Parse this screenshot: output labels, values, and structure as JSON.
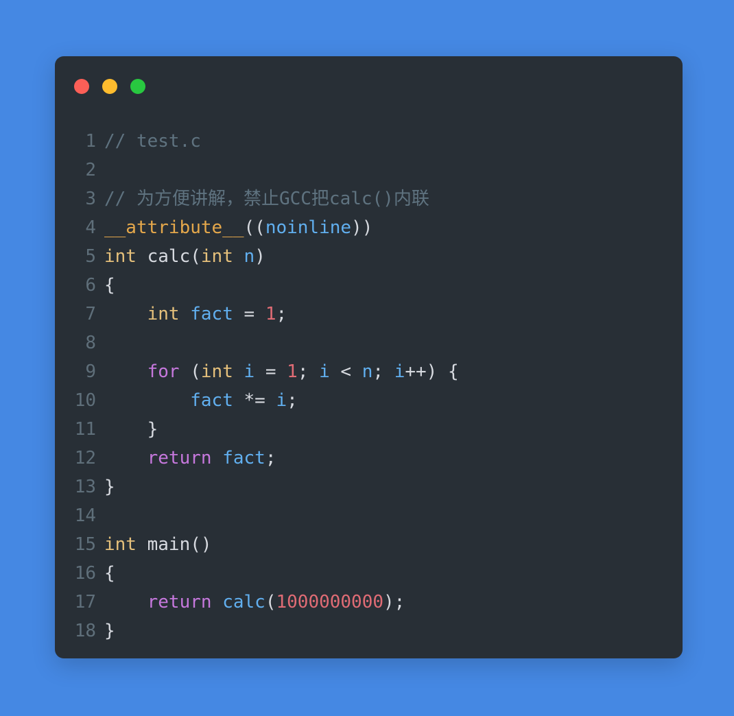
{
  "window": {
    "controls": [
      {
        "name": "close",
        "color": "#fc5f57"
      },
      {
        "name": "minimize",
        "color": "#febc2e"
      },
      {
        "name": "maximize",
        "color": "#28c840"
      }
    ],
    "background_color": "#4588e3",
    "card_color": "#282f36"
  },
  "editor": {
    "language": "c",
    "filename": "test.c",
    "gutter_color": "#5f6f7a",
    "lines": [
      {
        "n": "1",
        "tokens": [
          {
            "t": "// test.c",
            "c": "t-comment"
          }
        ]
      },
      {
        "n": "2",
        "tokens": []
      },
      {
        "n": "3",
        "tokens": [
          {
            "t": "// 为方便讲解，禁止GCC把calc()内联",
            "c": "t-comment"
          }
        ]
      },
      {
        "n": "4",
        "tokens": [
          {
            "t": "__attribute__",
            "c": "t-attr"
          },
          {
            "t": "((",
            "c": "t-punct"
          },
          {
            "t": "noinline",
            "c": "t-var"
          },
          {
            "t": "))",
            "c": "t-punct"
          }
        ]
      },
      {
        "n": "5",
        "tokens": [
          {
            "t": "int",
            "c": "t-type"
          },
          {
            "t": " ",
            "c": "t-plain"
          },
          {
            "t": "calc",
            "c": "t-func"
          },
          {
            "t": "(",
            "c": "t-punct"
          },
          {
            "t": "int",
            "c": "t-type"
          },
          {
            "t": " ",
            "c": "t-plain"
          },
          {
            "t": "n",
            "c": "t-param"
          },
          {
            "t": ")",
            "c": "t-punct"
          }
        ]
      },
      {
        "n": "6",
        "tokens": [
          {
            "t": "{",
            "c": "t-punct"
          }
        ]
      },
      {
        "n": "7",
        "tokens": [
          {
            "t": "    ",
            "c": "t-plain"
          },
          {
            "t": "int",
            "c": "t-type"
          },
          {
            "t": " ",
            "c": "t-plain"
          },
          {
            "t": "fact",
            "c": "t-var"
          },
          {
            "t": " = ",
            "c": "t-punct"
          },
          {
            "t": "1",
            "c": "t-number"
          },
          {
            "t": ";",
            "c": "t-punct"
          }
        ]
      },
      {
        "n": "8",
        "tokens": []
      },
      {
        "n": "9",
        "tokens": [
          {
            "t": "    ",
            "c": "t-plain"
          },
          {
            "t": "for",
            "c": "t-keyword"
          },
          {
            "t": " (",
            "c": "t-punct"
          },
          {
            "t": "int",
            "c": "t-type"
          },
          {
            "t": " ",
            "c": "t-plain"
          },
          {
            "t": "i",
            "c": "t-var"
          },
          {
            "t": " = ",
            "c": "t-punct"
          },
          {
            "t": "1",
            "c": "t-number"
          },
          {
            "t": "; ",
            "c": "t-punct"
          },
          {
            "t": "i",
            "c": "t-var"
          },
          {
            "t": " < ",
            "c": "t-punct"
          },
          {
            "t": "n",
            "c": "t-var"
          },
          {
            "t": "; ",
            "c": "t-punct"
          },
          {
            "t": "i",
            "c": "t-var"
          },
          {
            "t": "++) {",
            "c": "t-punct"
          }
        ]
      },
      {
        "n": "10",
        "tokens": [
          {
            "t": "        ",
            "c": "t-plain"
          },
          {
            "t": "fact",
            "c": "t-var"
          },
          {
            "t": " *= ",
            "c": "t-punct"
          },
          {
            "t": "i",
            "c": "t-var"
          },
          {
            "t": ";",
            "c": "t-punct"
          }
        ]
      },
      {
        "n": "11",
        "tokens": [
          {
            "t": "    ",
            "c": "t-plain"
          },
          {
            "t": "}",
            "c": "t-punct"
          }
        ]
      },
      {
        "n": "12",
        "tokens": [
          {
            "t": "    ",
            "c": "t-plain"
          },
          {
            "t": "return",
            "c": "t-keyword"
          },
          {
            "t": " ",
            "c": "t-plain"
          },
          {
            "t": "fact",
            "c": "t-var"
          },
          {
            "t": ";",
            "c": "t-punct"
          }
        ]
      },
      {
        "n": "13",
        "tokens": [
          {
            "t": "}",
            "c": "t-punct"
          }
        ]
      },
      {
        "n": "14",
        "tokens": []
      },
      {
        "n": "15",
        "tokens": [
          {
            "t": "int",
            "c": "t-type"
          },
          {
            "t": " ",
            "c": "t-plain"
          },
          {
            "t": "main",
            "c": "t-func"
          },
          {
            "t": "()",
            "c": "t-punct"
          }
        ]
      },
      {
        "n": "16",
        "tokens": [
          {
            "t": "{",
            "c": "t-punct"
          }
        ]
      },
      {
        "n": "17",
        "tokens": [
          {
            "t": "    ",
            "c": "t-plain"
          },
          {
            "t": "return",
            "c": "t-keyword"
          },
          {
            "t": " ",
            "c": "t-plain"
          },
          {
            "t": "calc",
            "c": "t-call"
          },
          {
            "t": "(",
            "c": "t-punct"
          },
          {
            "t": "1000000000",
            "c": "t-number"
          },
          {
            "t": ");",
            "c": "t-punct"
          }
        ]
      },
      {
        "n": "18",
        "tokens": [
          {
            "t": "}",
            "c": "t-punct"
          }
        ]
      }
    ],
    "source_text": "// test.c\n\n// 为方便讲解，禁止GCC把calc()内联\n__attribute__((noinline))\nint calc(int n)\n{\n    int fact = 1;\n\n    for (int i = 1; i < n; i++) {\n        fact *= i;\n    }\n    return fact;\n}\n\nint main()\n{\n    return calc(1000000000);\n}"
  }
}
